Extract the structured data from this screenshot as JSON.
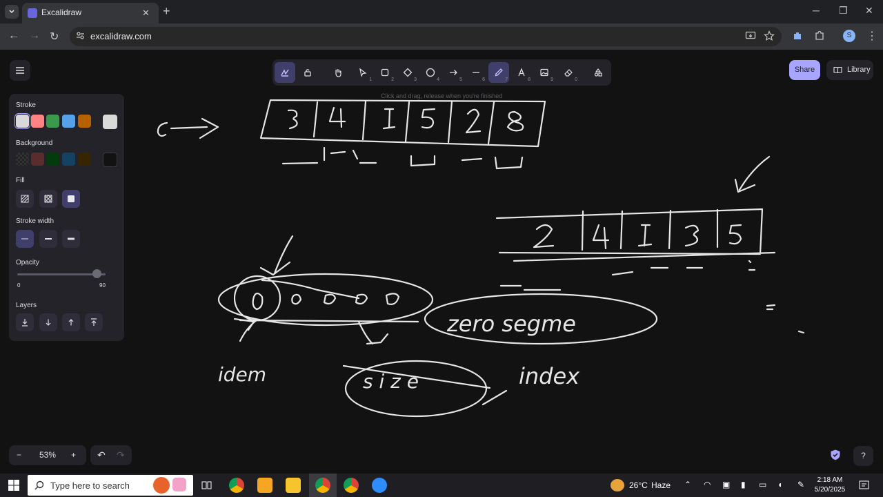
{
  "browser": {
    "tab_title": "Excalidraw",
    "url": "excalidraw.com",
    "profile_initial": "S"
  },
  "toolbar": {
    "tools": [
      {
        "name": "lock",
        "key": ""
      },
      {
        "name": "hand",
        "key": ""
      },
      {
        "name": "selection",
        "key": "1"
      },
      {
        "name": "rectangle",
        "key": "2"
      },
      {
        "name": "diamond",
        "key": "3"
      },
      {
        "name": "ellipse",
        "key": "4"
      },
      {
        "name": "arrow",
        "key": "5"
      },
      {
        "name": "line",
        "key": "6"
      },
      {
        "name": "draw",
        "key": "7"
      },
      {
        "name": "text",
        "key": "8"
      },
      {
        "name": "image",
        "key": "9"
      },
      {
        "name": "eraser",
        "key": "0"
      }
    ],
    "hint": "Click and drag, release when you're finished"
  },
  "header": {
    "share_label": "Share",
    "library_label": "Library"
  },
  "properties": {
    "stroke_label": "Stroke",
    "stroke_colors": [
      "#d9d9d9",
      "#ff8383",
      "#3a994c",
      "#56a2e8",
      "#b76100"
    ],
    "stroke_current": "#d9d9d9",
    "background_label": "Background",
    "background_colors": [
      "transparent",
      "#5b2c2c",
      "#043b0c",
      "#154163",
      "#362500"
    ],
    "background_current": "#121212",
    "fill_label": "Fill",
    "stroke_width_label": "Stroke width",
    "opacity_label": "Opacity",
    "opacity_min": "0",
    "opacity_value": "90",
    "opacity_fraction": 0.9,
    "layers_label": "Layers"
  },
  "footer": {
    "zoom_minus": "−",
    "zoom_value": "53%",
    "zoom_plus": "+",
    "undo": "↶",
    "redo": "↷",
    "help": "?"
  },
  "taskbar": {
    "search_placeholder": "Type here to search",
    "temperature": "26°C",
    "condition": "Haze",
    "time": "2:18 AM",
    "date": "5/20/2025"
  }
}
